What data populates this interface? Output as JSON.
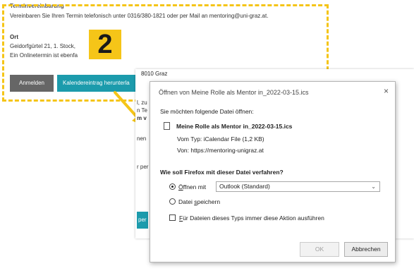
{
  "page": {
    "section_heading": "Terminvereinbarung",
    "contact_text": "Vereinbaren Sie Ihren Termin telefonisch unter 0316/380-1821 oder per Mail an mentoring@uni-graz.at.",
    "ort_heading": "Ort",
    "address_line": "Geidorfgürtel 21, 1. Stock,",
    "online_line": "Ein Onlinetermin ist ebenfa",
    "btn_anmelden": "Anmelden",
    "btn_kalender": "Kalendereintrag herunterla",
    "step_number": "2",
    "bg_address": "8010 Graz",
    "bg_snippets": [
      "l, zu",
      "n Te",
      "m v",
      "nen",
      "r per",
      "per"
    ]
  },
  "dialog": {
    "title": "Öffnen von Meine Rolle als Mentor in_2022-03-15.ics",
    "close_icon": "×",
    "prompt": "Sie möchten folgende Datei öffnen:",
    "file_name": "Meine Rolle als Mentor in_2022-03-15.ics",
    "file_type": "Vom Typ: iCalendar File (1,2 KB)",
    "file_source": "Von: https://mentoring-unigraz.at",
    "question": "Wie soll Firefox mit dieser Datei verfahren?",
    "open_with_prefix": "",
    "open_with_accel": "Ö",
    "open_with_rest": "ffnen mit",
    "open_with_selected": true,
    "app_select": "Outlook (Standard)",
    "save_prefix": "Datei ",
    "save_accel": "s",
    "save_rest": "peichern",
    "always_accel": "F",
    "always_rest": "ür Dateien dieses Typs immer diese Aktion ausführen",
    "always_checked": false,
    "ok_label": "OK",
    "cancel_label": "Abbrechen"
  },
  "colors": {
    "highlight": "#f5c518",
    "teal_button": "#1c9bac",
    "gray_button": "#666666"
  }
}
